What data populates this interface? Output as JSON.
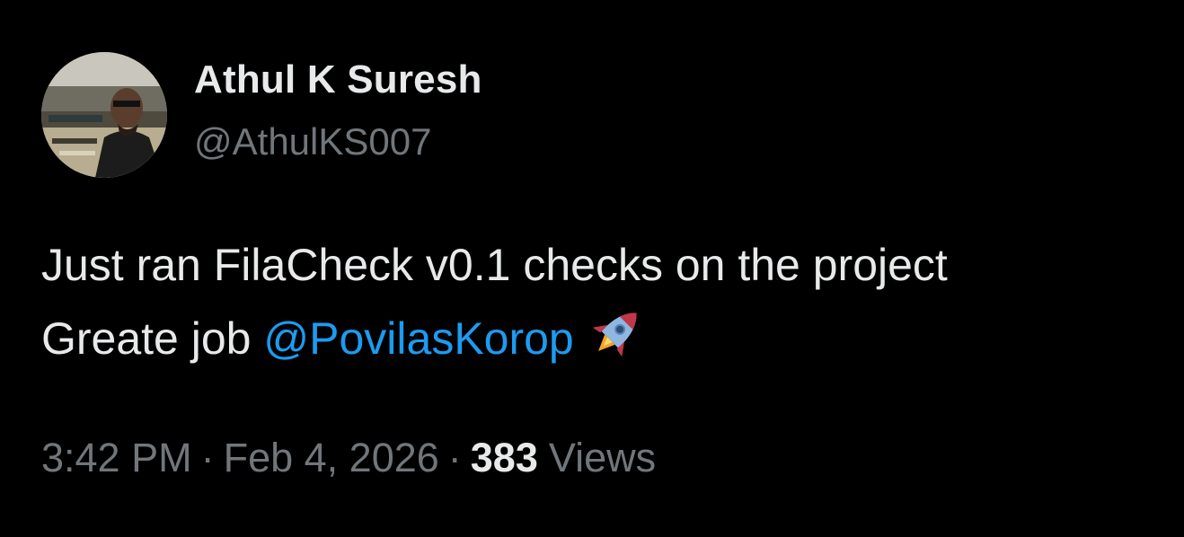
{
  "tweet": {
    "author": {
      "display_name": "Athul K Suresh",
      "handle": "@AthulKS007"
    },
    "text": {
      "line1": "Just ran FilaCheck v0.1 checks on the project",
      "line2_prefix": "Greate job ",
      "mention": "@PovilasKorop",
      "emoji_icon": "rocket-icon"
    },
    "meta": {
      "time": "3:42 PM",
      "separator": "·",
      "date": "Feb 4, 2026",
      "views_count": "383",
      "views_label": "Views"
    }
  },
  "colors": {
    "background": "#000000",
    "primary_text": "#e7e9ea",
    "secondary_text": "#71767b",
    "mention": "#1d9bf0"
  }
}
